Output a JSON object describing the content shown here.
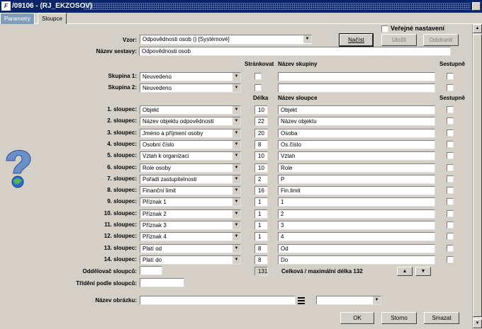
{
  "window": {
    "title": "/09106 - (RJ_EKZOSOV)",
    "app_icon": "F"
  },
  "tabs": [
    {
      "label": "Parametry"
    },
    {
      "label": "Sloupce"
    }
  ],
  "top": {
    "vzor_label": "Vzor:",
    "vzor_value": "Odpovědnosti osob  ()   [Systémové]",
    "verejne_label": "Veřejné nastavení",
    "nacist_label": "Načíst",
    "ulozit_label": "Uložit",
    "odstranit_label": "Odstranit",
    "nazev_sestavy_label": "Název sestavy:",
    "nazev_sestavy_value": "Odpovědnosti osob"
  },
  "groups": {
    "stránkovat_header": "Stránkovat",
    "nazev_skupiny_header": "Název skupiny",
    "sestupne_header": "Sestupně",
    "rows": [
      {
        "label": "Skupina 1:",
        "value": "Neuvedeno",
        "name": ""
      },
      {
        "label": "Skupina 2:",
        "value": "Neuvedeno",
        "name": ""
      }
    ]
  },
  "columns": {
    "delka_header": "Délka",
    "nazev_sloupce_header": "Název sloupce",
    "sestupne_header": "Sestupně",
    "rows": [
      {
        "label": "1. sloupec:",
        "value": "Objekt",
        "length": "10",
        "name": "Objekt"
      },
      {
        "label": "2. sloupec:",
        "value": "Název objektu odpovědnosti",
        "length": "22",
        "name": "Název objektu"
      },
      {
        "label": "3. sloupec:",
        "value": "Jméno a příjmení osoby",
        "length": "20",
        "name": "Osoba"
      },
      {
        "label": "4. sloupec:",
        "value": "Osobní číslo",
        "length": "8",
        "name": "Os.číslo"
      },
      {
        "label": "5. sloupec:",
        "value": "Vztah k organizaci",
        "length": "10",
        "name": "Vztah"
      },
      {
        "label": "6. sloupec:",
        "value": "Role osoby",
        "length": "10",
        "name": "Role"
      },
      {
        "label": "7. sloupec:",
        "value": "Pořadí zastupitelnosti",
        "length": "2",
        "name": "P"
      },
      {
        "label": "8. sloupec:",
        "value": "Finanční limit",
        "length": "16",
        "name": "Fin.limit"
      },
      {
        "label": "9. sloupec:",
        "value": "Příznak 1",
        "length": "1",
        "name": "1"
      },
      {
        "label": "10. sloupec:",
        "value": "Příznak 2",
        "length": "1",
        "name": "2"
      },
      {
        "label": "11. sloupec:",
        "value": "Příznak 3",
        "length": "1",
        "name": "3"
      },
      {
        "label": "12. sloupec:",
        "value": "Příznak 4",
        "length": "1",
        "name": "4"
      },
      {
        "label": "13. sloupec:",
        "value": "Platí od",
        "length": "8",
        "name": "Od"
      },
      {
        "label": "14. sloupec:",
        "value": "Platí do",
        "length": "8",
        "name": "Do"
      }
    ]
  },
  "bottom": {
    "oddelovac_label": "Oddělovač sloupců:",
    "oddelovac_value": "",
    "total_length": "131",
    "total_text": "Celková / maximální délka 132",
    "trideni_label": "Třídění podle sloupců:",
    "trideni_value": "",
    "nazev_obrazku_label": "Název obrázku:",
    "nazev_obrazku_value": "",
    "obrazek_combo_value": "",
    "ok_label": "OK",
    "storno_label": "Storno",
    "smazat_label": "Smazat"
  },
  "icons": {
    "help": "help-question-icon",
    "list": "list-icon",
    "up": "arrow-up-icon",
    "down": "arrow-down-icon"
  },
  "colors": {
    "titlebar": "#0a246a",
    "panel": "#d4d0c8",
    "tab_inactive": "#7f9db9"
  }
}
